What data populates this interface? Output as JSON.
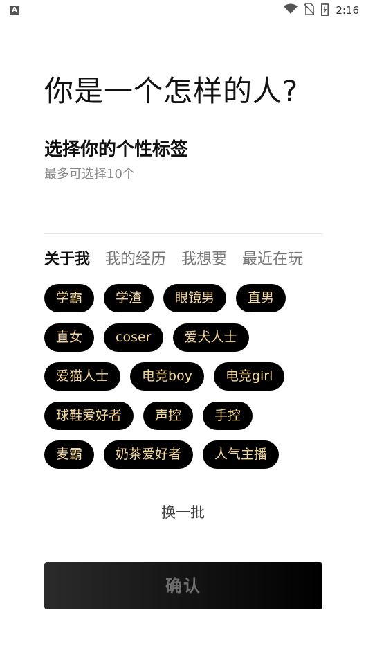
{
  "status_bar": {
    "app_icon_letter": "A",
    "time": "2:16",
    "icons": [
      "wifi-icon",
      "no-sim-icon",
      "battery-charging-icon"
    ]
  },
  "header": {
    "title": "你是一个怎样的人?",
    "subtitle": "选择你的个性标签",
    "hint": "最多可选择10个"
  },
  "tabs": [
    {
      "label": "关于我",
      "active": true
    },
    {
      "label": "我的经历",
      "active": false
    },
    {
      "label": "我想要",
      "active": false
    },
    {
      "label": "最近在玩",
      "active": false
    }
  ],
  "tag_rows": [
    [
      "学霸",
      "学渣",
      "眼镜男",
      "直男"
    ],
    [
      "直女",
      "coser",
      "爱犬人士"
    ],
    [
      "爱猫人士",
      "电竞boy",
      "电竞girl"
    ],
    [
      "球鞋爱好者",
      "声控",
      "手控"
    ],
    [
      "麦霸",
      "奶茶爱好者",
      "人气主播"
    ]
  ],
  "refresh_label": "换一批",
  "confirm_label": "确认",
  "colors": {
    "tag_bg": "#000000",
    "tag_text": "#f3d79a"
  }
}
